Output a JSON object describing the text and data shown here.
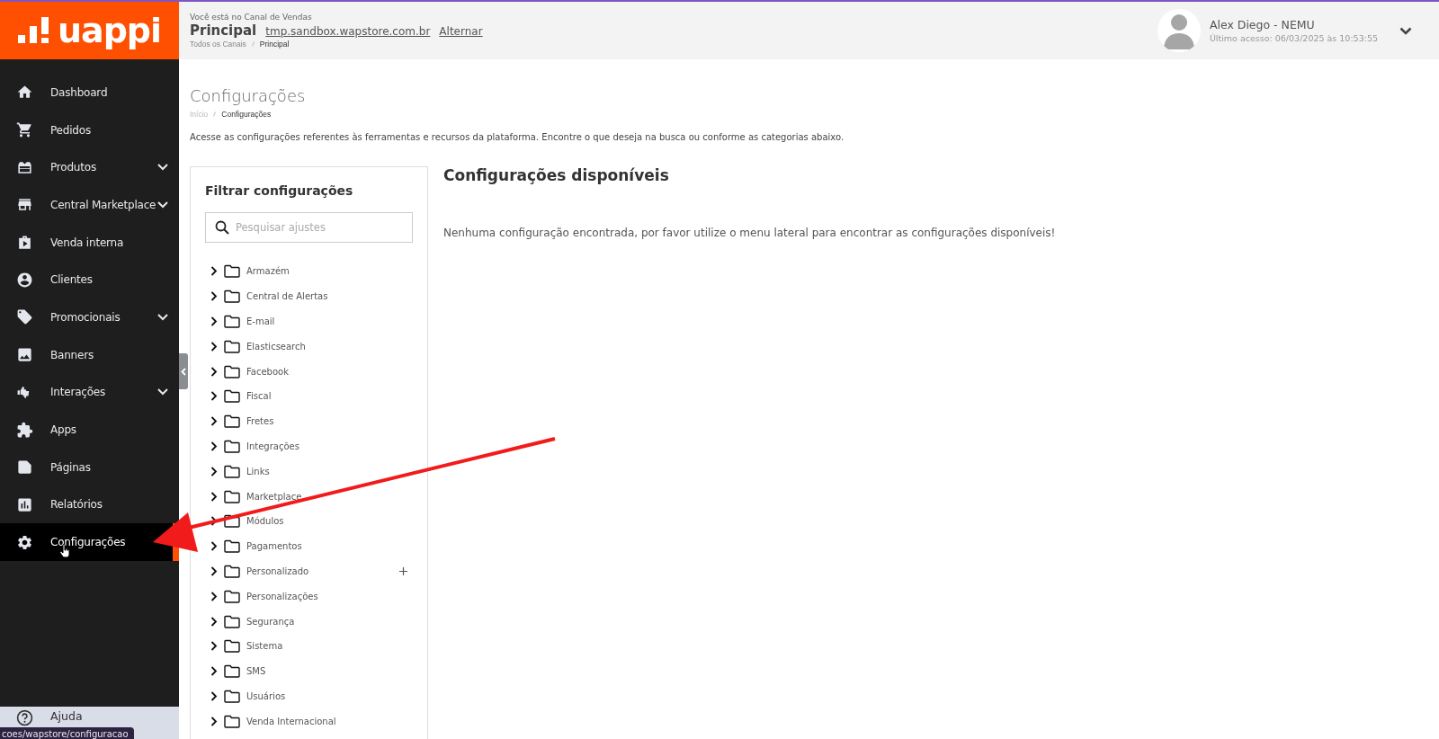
{
  "logo": {
    "text": "uappi"
  },
  "channel": {
    "label": "Você está no Canal de Vendas",
    "name": "Principal",
    "domain": "tmp.sandbox.wapstore.com.br",
    "switch_link": "Alternar",
    "breadcrumb": [
      "Todos os Canais",
      "Principal"
    ]
  },
  "user": {
    "name": "Alex Diego - NEMU",
    "last_access": "Último acesso: 06/03/2025 às 10:53:55"
  },
  "sidebar": {
    "items": [
      {
        "label": "Dashboard",
        "kind": "home",
        "expandable": false,
        "selected": false
      },
      {
        "label": "Pedidos",
        "kind": "cart",
        "expandable": false,
        "selected": false
      },
      {
        "label": "Produtos",
        "kind": "gift",
        "expandable": true,
        "selected": false
      },
      {
        "label": "Central Marketplace",
        "kind": "store",
        "expandable": true,
        "selected": false
      },
      {
        "label": "Venda interna",
        "kind": "play",
        "expandable": false,
        "selected": false
      },
      {
        "label": "Clientes",
        "kind": "account",
        "expandable": false,
        "selected": false
      },
      {
        "label": "Promocionais",
        "kind": "tag",
        "expandable": true,
        "selected": false
      },
      {
        "label": "Banners",
        "kind": "image",
        "expandable": false,
        "selected": false
      },
      {
        "label": "Interações",
        "kind": "thumbs",
        "expandable": true,
        "selected": false
      },
      {
        "label": "Apps",
        "kind": "puzzle",
        "expandable": false,
        "selected": false
      },
      {
        "label": "Páginas",
        "kind": "page",
        "expandable": false,
        "selected": false
      },
      {
        "label": "Relatórios",
        "kind": "chart",
        "expandable": false,
        "selected": false
      },
      {
        "label": "Configurações",
        "kind": "gear",
        "expandable": false,
        "selected": true
      }
    ],
    "help": "Ajuda"
  },
  "page": {
    "title": "Configurações",
    "breadcrumb": [
      "Início",
      "Configurações"
    ],
    "description": "Acesse as configurações referentes às ferramentas e recursos da plataforma. Encontre o que deseja na busca ou conforme as categorias abaixo."
  },
  "filter": {
    "title": "Filtrar configurações",
    "search_placeholder": "Pesquisar ajustes",
    "folders": [
      {
        "label": "Armazém",
        "addable": false
      },
      {
        "label": "Central de Alertas",
        "addable": false
      },
      {
        "label": "E-mail",
        "addable": false
      },
      {
        "label": "Elasticsearch",
        "addable": false
      },
      {
        "label": "Facebook",
        "addable": false
      },
      {
        "label": "Fiscal",
        "addable": false
      },
      {
        "label": "Fretes",
        "addable": false
      },
      {
        "label": "Integrações",
        "addable": false
      },
      {
        "label": "Links",
        "addable": false
      },
      {
        "label": "Marketplace",
        "addable": false
      },
      {
        "label": "Módulos",
        "addable": false
      },
      {
        "label": "Pagamentos",
        "addable": false
      },
      {
        "label": "Personalizado",
        "addable": true
      },
      {
        "label": "Personalizações",
        "addable": false
      },
      {
        "label": "Segurança",
        "addable": false
      },
      {
        "label": "Sistema",
        "addable": false
      },
      {
        "label": "SMS",
        "addable": false
      },
      {
        "label": "Usuários",
        "addable": false
      },
      {
        "label": "Venda Internacional",
        "addable": false
      }
    ]
  },
  "results": {
    "title": "Configurações disponíveis",
    "message": "Nenhuma configuração encontrada, por favor utilize o menu lateral para encontrar as configurações disponíveis!"
  },
  "status_link": "coes/wapstore/configuracao"
}
